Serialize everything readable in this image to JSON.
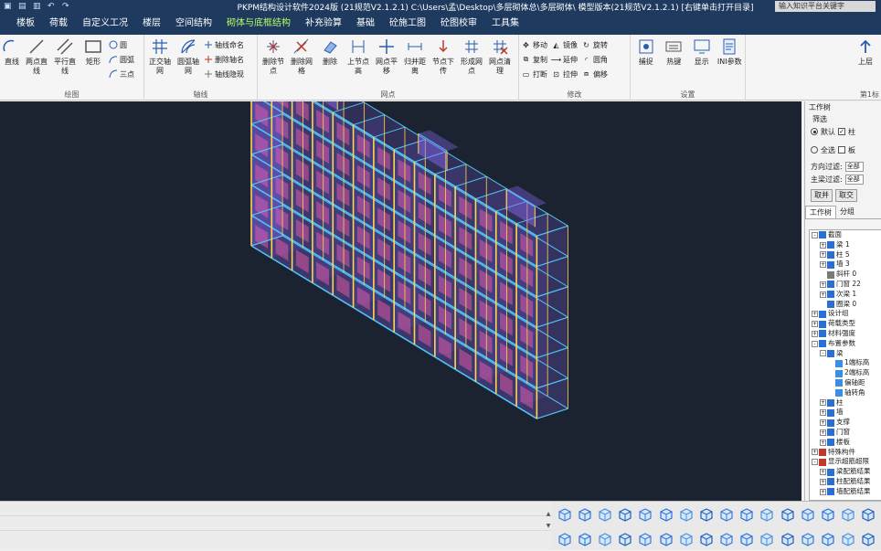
{
  "window": {
    "title": "PKPM结构设计软件2024版 (21规范V2.1.2.1) C:\\Users\\孟\\Desktop\\多层砌体总\\多层砌体\\ 模型版本(21规范V2.1.2.1)  [右键单击打开目录]",
    "search_placeholder": "输入知识平台关键字"
  },
  "menu": {
    "tabs": [
      "楼板",
      "荷载",
      "自定义工况",
      "楼层",
      "空间结构",
      "砌体与底框结构",
      "补充验算",
      "基础",
      "砼施工图",
      "砼图校审",
      "工具集"
    ]
  },
  "ribbon": {
    "draw": {
      "name": "绘图",
      "buttons": [
        "直线",
        "两点直线",
        "平行直线",
        "矩形"
      ],
      "small": [
        "圆",
        "圆弧",
        "三点"
      ]
    },
    "axis": {
      "name": "轴线",
      "buttons": [
        "正交轴网",
        "圆弧轴网"
      ],
      "small": [
        "轴线命名",
        "删除轴名",
        "轴线隐现"
      ]
    },
    "node": {
      "name": "网点",
      "buttons": [
        "删除节点",
        "删除网格",
        "删除",
        "上节点高",
        "网点平移",
        "归并距离",
        "节点下传",
        "形成网点",
        "网点清理"
      ]
    },
    "modify": {
      "name": "修改",
      "small": [
        "移动",
        "复制",
        "打断",
        "镜像",
        "延伸",
        "拉伸",
        "旋转",
        "圆角",
        "偏移"
      ]
    },
    "settings": {
      "name": "设置",
      "buttons": [
        "捕捉",
        "热键",
        "显示",
        "INI参数"
      ]
    },
    "extra": {
      "buttons": [
        "上层",
        "第1标"
      ]
    }
  },
  "panel": {
    "title": "工作树",
    "filter_label": "筛选",
    "radio_default": "默认",
    "radio_all": "全选",
    "check_column": "柱",
    "check_slab": "板",
    "direction_label": "方向过滤:",
    "direction_value": "全部",
    "mainbeam_label": "主梁过滤:",
    "mainbeam_value": "全部",
    "btn_union": "取并",
    "btn_intersect": "取交",
    "tab_worktree": "工作树",
    "tab_group": "分组",
    "tree": [
      {
        "label": "截面",
        "level": 0,
        "toggle": "-",
        "icon": "#2a6fd6"
      },
      {
        "label": "梁 1",
        "level": 1,
        "toggle": "+",
        "icon": "#2a6fd6"
      },
      {
        "label": "柱 5",
        "level": 1,
        "toggle": "+",
        "icon": "#2a6fd6"
      },
      {
        "label": "墙 3",
        "level": 1,
        "toggle": "+",
        "icon": "#2a6fd6"
      },
      {
        "label": "斜杆 0",
        "level": 1,
        "toggle": "",
        "icon": "#7a7a7a"
      },
      {
        "label": "门窗 22",
        "level": 1,
        "toggle": "+",
        "icon": "#2a6fd6"
      },
      {
        "label": "次梁 1",
        "level": 1,
        "toggle": "+",
        "icon": "#2a6fd6"
      },
      {
        "label": "圈梁 0",
        "level": 1,
        "toggle": "",
        "icon": "#2a6fd6"
      },
      {
        "label": "设计组",
        "level": 0,
        "toggle": "+",
        "icon": "#2a6fd6"
      },
      {
        "label": "荷载类型",
        "level": 0,
        "toggle": "+",
        "icon": "#2a6fd6"
      },
      {
        "label": "材料强度",
        "level": 0,
        "toggle": "+",
        "icon": "#2a6fd6"
      },
      {
        "label": "布置参数",
        "level": 0,
        "toggle": "-",
        "icon": "#2a6fd6"
      },
      {
        "label": "梁",
        "level": 1,
        "toggle": "-",
        "icon": "#2a6fd6"
      },
      {
        "label": "1端标高",
        "level": 2,
        "toggle": "",
        "icon": "#3a8ee6"
      },
      {
        "label": "2端标高",
        "level": 2,
        "toggle": "",
        "icon": "#3a8ee6"
      },
      {
        "label": "偏轴距",
        "level": 2,
        "toggle": "",
        "icon": "#3a8ee6"
      },
      {
        "label": "轴转角",
        "level": 2,
        "toggle": "",
        "icon": "#3a8ee6"
      },
      {
        "label": "柱",
        "level": 1,
        "toggle": "+",
        "icon": "#2a6fd6"
      },
      {
        "label": "墙",
        "level": 1,
        "toggle": "+",
        "icon": "#2a6fd6"
      },
      {
        "label": "支撑",
        "level": 1,
        "toggle": "+",
        "icon": "#2a6fd6"
      },
      {
        "label": "门窗",
        "level": 1,
        "toggle": "+",
        "icon": "#2a6fd6"
      },
      {
        "label": "楼板",
        "level": 1,
        "toggle": "+",
        "icon": "#2a6fd6"
      },
      {
        "label": "特殊构件",
        "level": 0,
        "toggle": "+",
        "icon": "#c0392b"
      },
      {
        "label": "显示超筋超限",
        "level": 0,
        "toggle": "-",
        "icon": "#c0392b"
      },
      {
        "label": "梁配筋结果",
        "level": 1,
        "toggle": "+",
        "icon": "#2a6fd6"
      },
      {
        "label": "柱配筋结果",
        "level": 1,
        "toggle": "+",
        "icon": "#2a6fd6"
      },
      {
        "label": "墙配筋结果",
        "level": 1,
        "toggle": "+",
        "icon": "#2a6fd6"
      }
    ]
  },
  "colors": {
    "title_bg": "#1e3a5f",
    "active_tab": "#b6ff66",
    "viewport_bg": "#1b2331",
    "beam": "#4fc3f7",
    "column": "#ffd54f",
    "wall": "#8e6cff",
    "window": "#ff5fb0"
  }
}
